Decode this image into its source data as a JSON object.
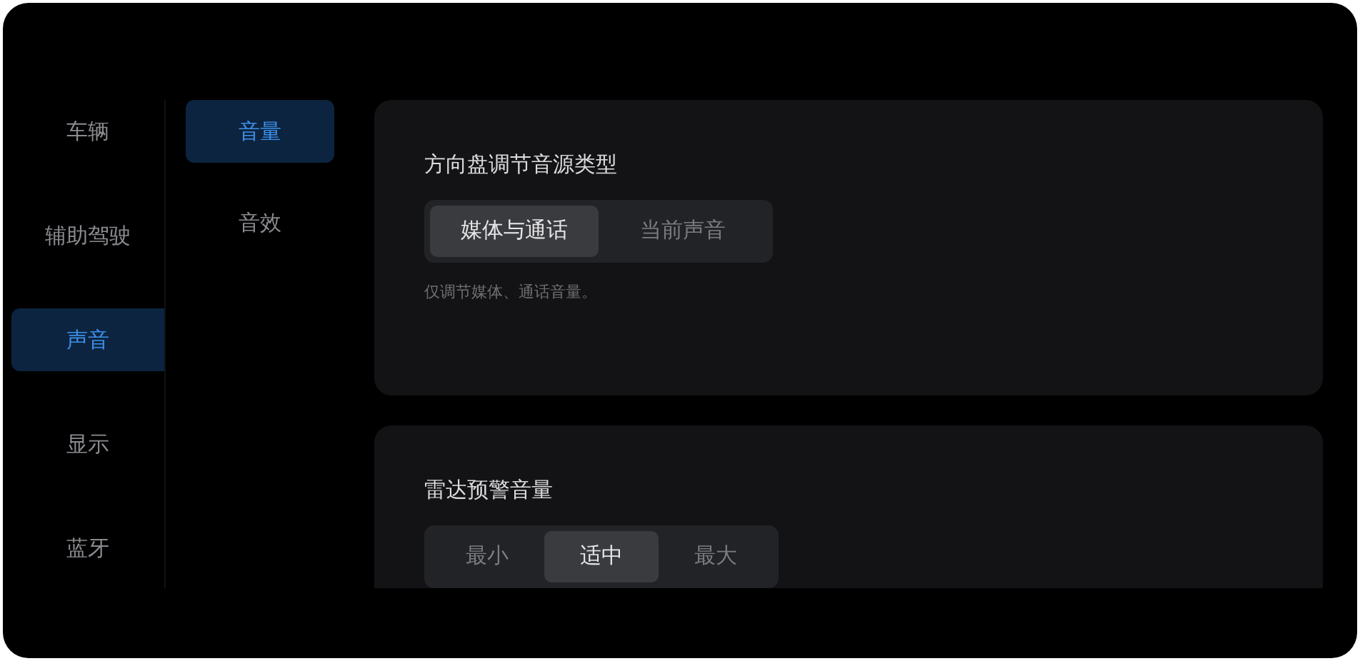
{
  "sidebar": {
    "items": [
      {
        "label": "车辆",
        "selected": false
      },
      {
        "label": "辅助驾驶",
        "selected": false
      },
      {
        "label": "声音",
        "selected": true
      },
      {
        "label": "显示",
        "selected": false
      },
      {
        "label": "蓝牙",
        "selected": false
      }
    ]
  },
  "submenu": {
    "items": [
      {
        "label": "音量",
        "selected": true
      },
      {
        "label": "音效",
        "selected": false
      }
    ]
  },
  "sections": [
    {
      "title": "方向盘调节音源类型",
      "options": [
        {
          "label": "媒体与通话",
          "selected": true
        },
        {
          "label": "当前声音",
          "selected": false
        }
      ],
      "note": "仅调节媒体、通话音量。"
    },
    {
      "title": "雷达预警音量",
      "options": [
        {
          "label": "最小",
          "selected": false
        },
        {
          "label": "适中",
          "selected": true
        },
        {
          "label": "最大",
          "selected": false
        }
      ]
    }
  ]
}
